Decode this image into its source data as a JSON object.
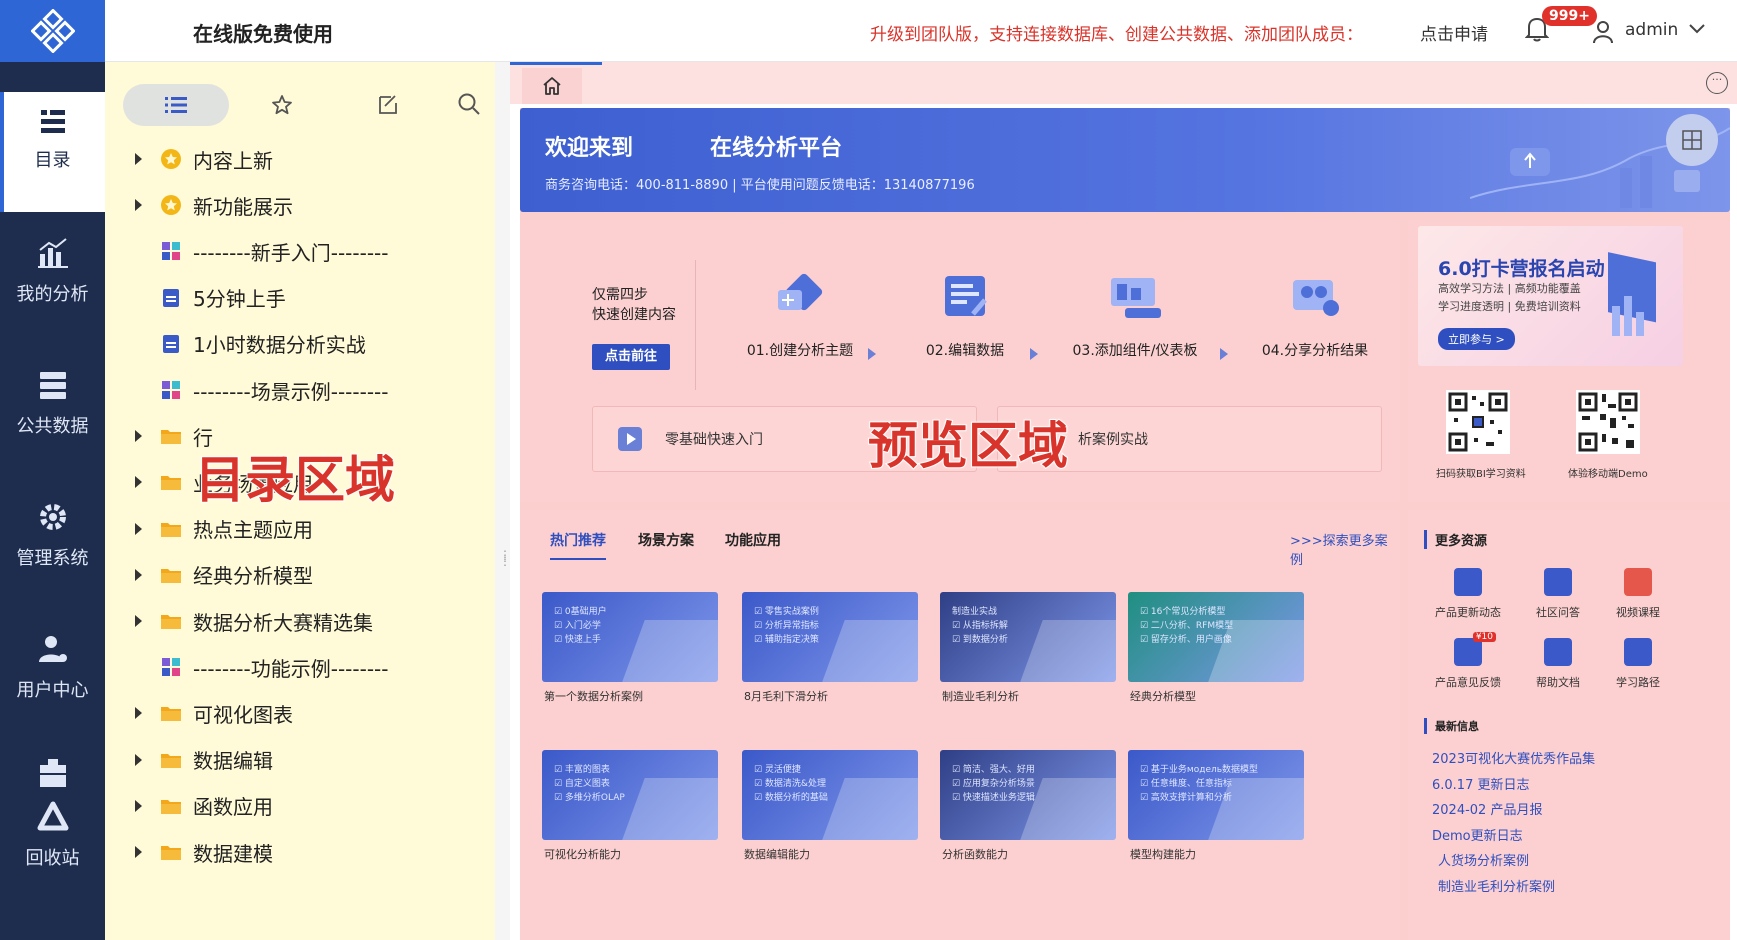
{
  "colors": {
    "nav_bg": "#1e2d4d",
    "brand_blue": "#2f66d6",
    "catalog_bg": "#fffbd8",
    "preview_overlay": "#fccfcf",
    "promo_red": "#d9342b"
  },
  "nav": {
    "items": [
      {
        "label": "目录",
        "icon": "catalog-icon"
      },
      {
        "label": "我的分析",
        "icon": "analysis-icon"
      },
      {
        "label": "公共数据",
        "icon": "database-icon"
      },
      {
        "label": "管理系统",
        "icon": "gear-icon"
      },
      {
        "label": "用户中心",
        "icon": "user-settings-icon"
      },
      {
        "label": "回收站",
        "icon": "recycle-icon"
      }
    ]
  },
  "header": {
    "title": "在线版免费使用",
    "promo": "升级到团队版，支持连接数据库、创建公共数据、添加团队成员：",
    "apply": "点击申请",
    "badge": "999+",
    "user": "admin"
  },
  "catalog": {
    "tree": [
      {
        "label": "内容上新",
        "type": "star-folder",
        "expandable": true
      },
      {
        "label": "新功能展示",
        "type": "star-folder",
        "expandable": true
      },
      {
        "label": "--------新手入门--------",
        "type": "dashboard",
        "expandable": false
      },
      {
        "label": "5分钟上手",
        "type": "doc",
        "expandable": false
      },
      {
        "label": "1小时数据分析实战",
        "type": "doc",
        "expandable": false
      },
      {
        "label": "--------场景示例--------",
        "type": "dashboard",
        "expandable": false
      },
      {
        "label": "行",
        "type": "folder",
        "expandable": true
      },
      {
        "label": "业务场景应用",
        "type": "folder",
        "expandable": true
      },
      {
        "label": "热点主题应用",
        "type": "folder",
        "expandable": true
      },
      {
        "label": "经典分析模型",
        "type": "folder",
        "expandable": true
      },
      {
        "label": "数据分析大赛精选集",
        "type": "folder",
        "expandable": true
      },
      {
        "label": "--------功能示例--------",
        "type": "dashboard",
        "expandable": false
      },
      {
        "label": "可视化图表",
        "type": "folder",
        "expandable": true
      },
      {
        "label": "数据编辑",
        "type": "folder",
        "expandable": true
      },
      {
        "label": "函数应用",
        "type": "folder",
        "expandable": true
      },
      {
        "label": "数据建模",
        "type": "folder",
        "expandable": true
      }
    ],
    "overlay_label": "目录区域"
  },
  "preview": {
    "overlay_label": "预览区域",
    "banner": {
      "welcome": "欢迎来到",
      "platform": "在线分析平台",
      "phones": "商务咨询电话：400-811-8890    |    平台使用问题反馈电话：13140877196"
    },
    "steps": {
      "intro_line1": "仅需四步",
      "intro_line2": "快速创建内容",
      "go": "点击前往",
      "items": [
        "01.创建分析主题",
        "02.编辑数据",
        "03.添加组件/仪表板",
        "04.分享分析结果"
      ],
      "entry1": "零基础快速入门",
      "entry2": "析案例实战"
    },
    "ad": {
      "title": "6.0打卡营报名启动",
      "line1": "高效学习方法 | 高频功能覆盖",
      "line2": "学习进度透明 | 免费培训资料",
      "button": "立即参与 >"
    },
    "qr": [
      {
        "caption": "扫码获取BI学习资料"
      },
      {
        "caption": "体验移动端Demo"
      }
    ],
    "cases": {
      "tabs": [
        "热门推荐",
        "场景方案",
        "功能应用"
      ],
      "explore": ">>>探索更多案例",
      "cards": [
        {
          "caption": "第一个数据分析案例",
          "lines": [
            "☑ 0基础用户",
            "☑ 入门必学",
            "☑ 快速上手"
          ],
          "color": "#3b59c9"
        },
        {
          "caption": "8月毛利下滑分析",
          "lines": [
            "☑ 零售实战案例",
            "☑ 分析异常指标",
            "☑ 辅助指定决策"
          ],
          "color": "#3b59c9"
        },
        {
          "caption": "制造业毛利分析",
          "lines": [
            "制造业实战",
            "☑ 从指标拆解",
            "☑ 到数据分析"
          ],
          "color": "#2f3f86"
        },
        {
          "caption": "经典分析模型",
          "lines": [
            "☑ 16个常见分析模型",
            "☑ 二八分析、RFM模型",
            "☑ 留存分析、用户画像"
          ],
          "color": "#1f8f80"
        },
        {
          "caption": "可视化分析能力",
          "lines": [
            "☑ 丰富的图表",
            "☑ 自定义图表",
            "☑ 多维分析OLAP"
          ],
          "color": "#3b59c9"
        },
        {
          "caption": "数据编辑能力",
          "lines": [
            "☑ 灵活便捷",
            "☑ 数据清洗&处理",
            "☑ 数据分析的基础"
          ],
          "color": "#3b59c9"
        },
        {
          "caption": "分析函数能力",
          "lines": [
            "☑ 简洁、强大、好用",
            "☑ 应用复杂分析场景",
            "☑ 快速描述业务逻辑"
          ],
          "color": "#2f3f86"
        },
        {
          "caption": "模型构建能力",
          "lines": [
            "☑ 基于业务модель数据模型",
            "☑ 任意维度、任意指标",
            "☑ 高效支撑计算和分析"
          ],
          "color": "#3b59c9"
        }
      ]
    },
    "resources": {
      "title": "更多资源",
      "items": [
        {
          "label": "产品更新动态",
          "color": "#3b59c9"
        },
        {
          "label": "社区问答",
          "color": "#3b59c9"
        },
        {
          "label": "视频课程",
          "color": "#e5574a"
        },
        {
          "label": "产品意见反馈",
          "color": "#3b59c9",
          "badge": "¥10"
        },
        {
          "label": "帮助文档",
          "color": "#3b59c9"
        },
        {
          "label": "学习路径",
          "color": "#3b59c9"
        }
      ]
    },
    "news": {
      "title": "最新信息",
      "items": [
        "2023可视化大赛优秀作品集",
        "6.0.17 更新日志",
        "2024-02 产品月报",
        "Demo更新日志",
        "人货场分析案例",
        "制造业毛利分析案例"
      ]
    }
  }
}
